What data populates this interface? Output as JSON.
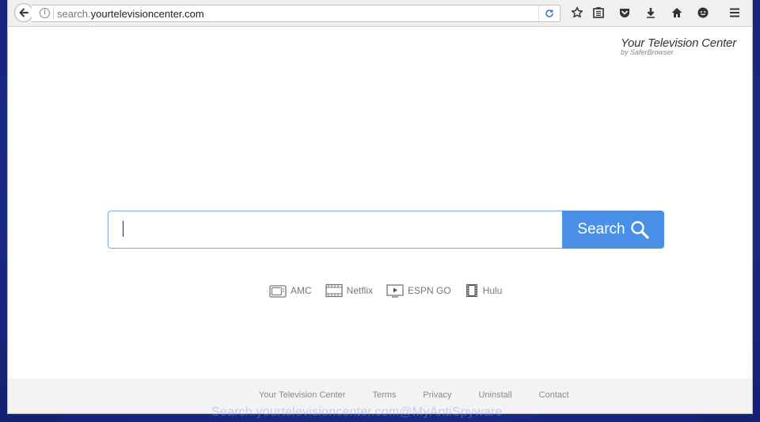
{
  "browser": {
    "url_prefix": "search.",
    "url_domain": "yourtelevisioncenter.com"
  },
  "page": {
    "brand_title": "Your Television Center",
    "brand_subtitle": "by SaferBrowser",
    "search_button_label": "Search",
    "search_value": "",
    "quick_links": [
      {
        "label": "AMC",
        "icon": "tv-icon"
      },
      {
        "label": "Netflix",
        "icon": "film-strip-icon"
      },
      {
        "label": "ESPN GO",
        "icon": "play-screen-icon"
      },
      {
        "label": "Hulu",
        "icon": "film-reel-icon"
      }
    ]
  },
  "footer": {
    "links": [
      "Your Television Center",
      "Terms",
      "Privacy",
      "Uninstall",
      "Contact"
    ]
  },
  "watermark": "Search.yourtelevisioncenter.com@MyAntiSpyware",
  "colors": {
    "desktop": "#1c2c8a",
    "search_button": "#4a90e8",
    "search_border": "#7aa6e6"
  }
}
